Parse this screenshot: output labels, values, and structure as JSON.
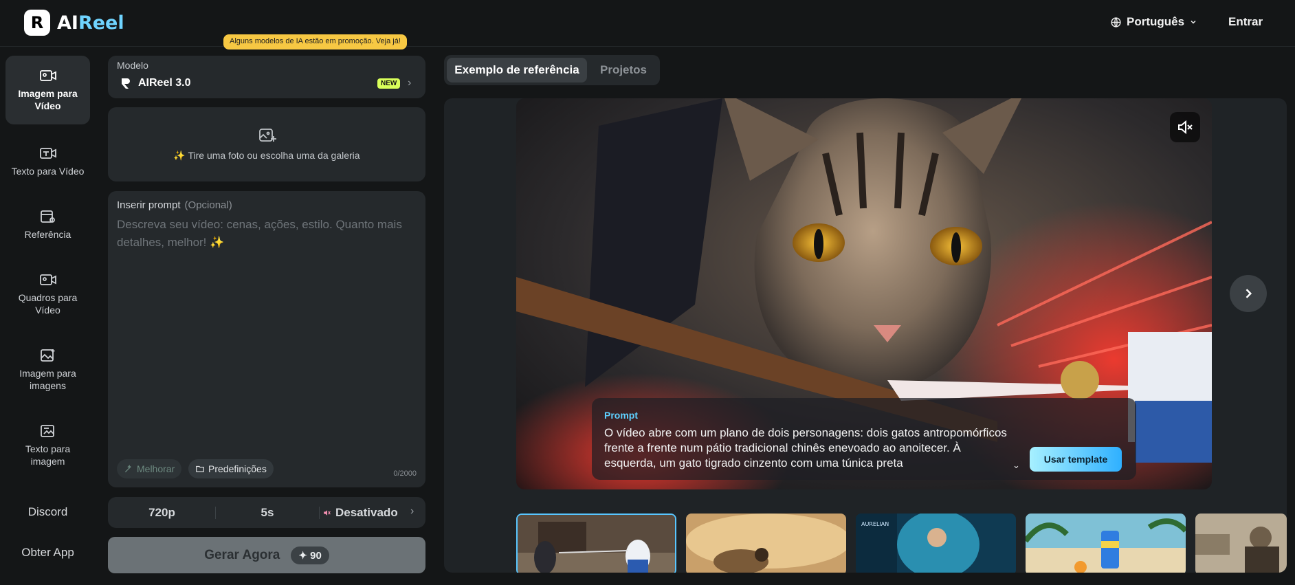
{
  "header": {
    "logo_badge": "R",
    "logo_text_a": "AI",
    "logo_text_b": "Reel",
    "language": "Português",
    "login": "Entrar"
  },
  "sidebar": {
    "items": [
      {
        "label_1": "Imagem para",
        "label_2": "Vídeo",
        "icon": "camera-image-icon",
        "active": true
      },
      {
        "label_1": "Texto para Vídeo",
        "label_2": "",
        "icon": "video-text-icon",
        "active": false
      },
      {
        "label_1": "Referência",
        "label_2": "",
        "icon": "reference-icon",
        "active": false
      },
      {
        "label_1": "Quadros para",
        "label_2": "Vídeo",
        "icon": "frames-video-icon",
        "active": false
      },
      {
        "label_1": "Imagem para",
        "label_2": "imagens",
        "icon": "image-edit-icon",
        "active": false
      },
      {
        "label_1": "Texto para",
        "label_2": "imagem",
        "icon": "text-image-icon",
        "active": false
      }
    ],
    "discord": "Discord",
    "get_app": "Obter App"
  },
  "promo_banner": "Alguns modelos de IA estão em promoção. Veja já!",
  "model": {
    "label": "Modelo",
    "name": "AIReel 3.0",
    "badge": "NEW"
  },
  "upload": {
    "text": "✨ Tire uma foto ou escolha uma da galeria"
  },
  "prompt": {
    "label": "Inserir prompt",
    "optional": "(Opcional)",
    "placeholder": "Descreva seu vídeo: cenas, ações, estilo. Quanto mais detalhes, melhor! ✨",
    "improve": "Melhorar",
    "presets": "Predefinições",
    "counter": "0/2000"
  },
  "options": {
    "resolution": "720p",
    "duration": "5s",
    "audio": "Desativado"
  },
  "generate": {
    "label": "Gerar Agora",
    "credits": "✦ 90"
  },
  "tabs": {
    "reference": "Exemplo de referência",
    "projects": "Projetos"
  },
  "example": {
    "prompt_label": "Prompt",
    "prompt_text": "O vídeo abre com um plano de dois personagens: dois gatos antropomórficos frente a frente num pátio tradicional chinês enevoado ao anoitecer. À esquerda, um gato tigrado cinzento com uma túnica preta",
    "use_template": "Usar template"
  },
  "colors": {
    "accent": "#59c6ff",
    "promo": "#f7c843",
    "new_badge": "#d9ff5a"
  }
}
